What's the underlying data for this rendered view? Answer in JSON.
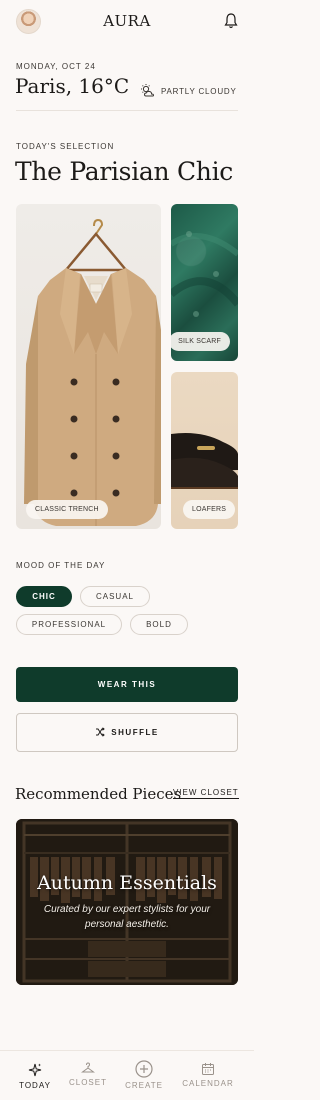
{
  "header": {
    "brand": "AURA",
    "avatar_icon": "user-avatar",
    "notification_icon": "bell-icon"
  },
  "weather": {
    "date": "MONDAY, OCT 24",
    "city_temp": "Paris, 16°C",
    "condition": "PARTLY CLOUDY",
    "condition_icon": "partly-cloudy-icon"
  },
  "selection": {
    "label": "TODAY'S SELECTION",
    "title": "The Parisian Chic",
    "items": [
      {
        "label": "CLASSIC TRENCH"
      },
      {
        "label": "SILK SCARF"
      },
      {
        "label": "LOAFERS"
      }
    ]
  },
  "mood": {
    "label": "MOOD OF THE DAY",
    "options": [
      "CHIC",
      "CASUAL",
      "PROFESSIONAL",
      "BOLD"
    ],
    "selected": "CHIC"
  },
  "actions": {
    "wear": "WEAR THIS",
    "shuffle": "SHUFFLE",
    "shuffle_icon": "shuffle-icon"
  },
  "recommended": {
    "title": "Recommended Pieces",
    "link": "VIEW CLOSET",
    "card_title": "Autumn Essentials",
    "card_subtitle": "Curated by our expert stylists for your personal aesthetic."
  },
  "nav": {
    "items": [
      {
        "label": "TODAY",
        "icon": "sparkle-icon",
        "active": true
      },
      {
        "label": "CLOSET",
        "icon": "hanger-icon",
        "active": false
      },
      {
        "label": "CREATE",
        "icon": "plus-circle-icon",
        "active": false
      },
      {
        "label": "CALENDAR",
        "icon": "calendar-icon",
        "active": false
      }
    ]
  },
  "colors": {
    "primary": "#0f3b2b",
    "background": "#fbf8f6",
    "text": "#1c1a18",
    "muted": "#9a928b"
  }
}
